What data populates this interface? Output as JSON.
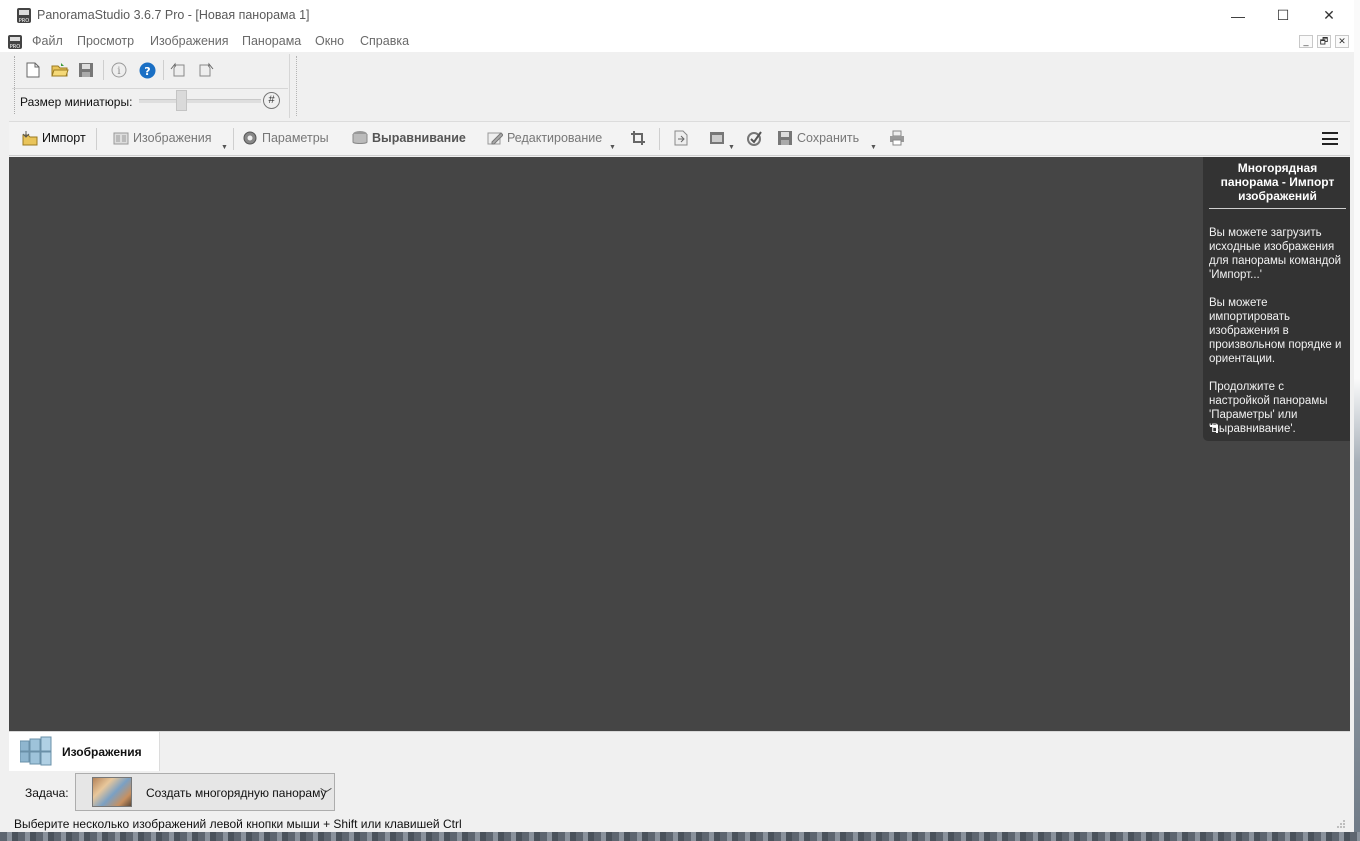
{
  "window": {
    "title": "PanoramaStudio 3.6.7 Pro - [Новая панорама 1]",
    "controls": {
      "minimize": "—",
      "maximize": "☐",
      "close": "✕"
    }
  },
  "menu": {
    "items": [
      "Файл",
      "Просмотр",
      "Изображения",
      "Панорама",
      "Окно",
      "Справка"
    ],
    "mdi": {
      "minimize": "_",
      "restore": "🗗",
      "close": "✕"
    }
  },
  "toolbar": {
    "icons": [
      "new-icon",
      "open-icon",
      "save-icon",
      "info-icon",
      "help-icon",
      "rotate-left-icon",
      "rotate-right-icon"
    ],
    "thumb_label": "Размер миниатюры:",
    "hash_label": "#",
    "thumbnail_size_fraction": 0.33
  },
  "ribbon": {
    "import": "Импорт",
    "images": "Изображения",
    "params": "Параметры",
    "align": "Выравнивание",
    "edit": "Редактирование",
    "save": "Сохранить"
  },
  "help": {
    "title": "Многорядная панорама - Импорт изображений",
    "p1": "Вы можете загрузить исходные изображения для панорамы командой 'Импорт...'",
    "p2": "Вы можете импортировать изображения в произвольном порядке и ориентации.",
    "p3": "Продолжите с настройкой панорамы 'Параметры' или 'Выравнивание'."
  },
  "tabs": {
    "images": "Изображения"
  },
  "task": {
    "label": "Задача:",
    "value": "Создать многорядную панораму"
  },
  "status": {
    "text": "Выберите несколько изображений левой кнопки мыши + Shift или клавишей Ctrl"
  },
  "colors": {
    "workspace": "#454545",
    "help_box": "#333333",
    "help_icon": "#1a6fc4"
  }
}
